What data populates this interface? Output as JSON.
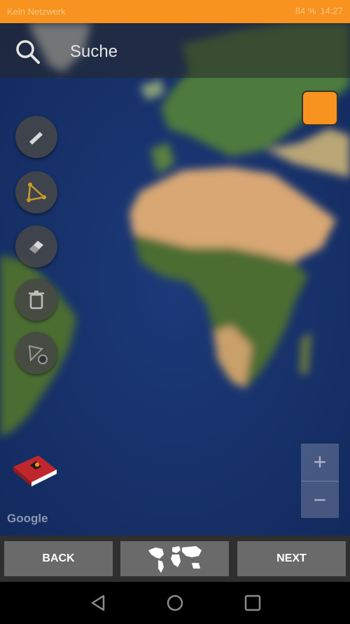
{
  "status_bar": {
    "carrier": "Kein Netzwerk",
    "time": "14:27",
    "battery": "84 %"
  },
  "search": {
    "placeholder": "Suche"
  },
  "map": {
    "attribution": "Google",
    "zoom_in": "+",
    "zoom_out": "−"
  },
  "bottom_bar": {
    "back_label": "BACK",
    "next_label": "NEXT"
  },
  "colors": {
    "accent": "#f7931e",
    "bottom_bar": "#2f2f2f",
    "button": "#6a6a6a"
  },
  "icons": [
    "search-icon",
    "pencil-icon",
    "polygon-icon",
    "eraser-icon",
    "trash-icon",
    "settings-icon",
    "book-icon",
    "world-map-icon",
    "back-triangle-icon",
    "home-circle-icon",
    "recents-square-icon"
  ]
}
